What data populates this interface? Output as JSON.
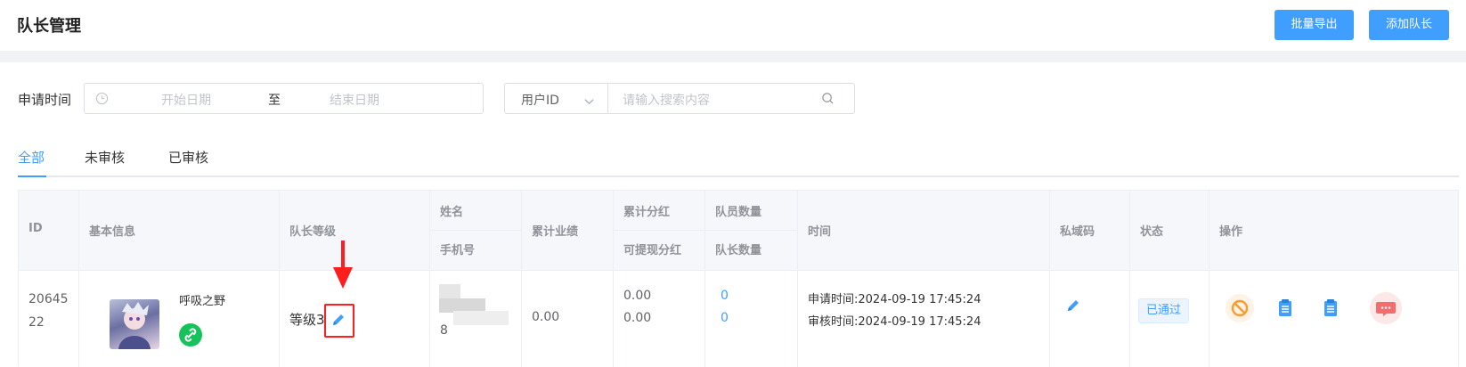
{
  "header": {
    "title": "队长管理",
    "export_label": "批量导出",
    "add_label": "添加队长"
  },
  "filters": {
    "date_label": "申请时间",
    "start_placeholder": "开始日期",
    "range_separator": "至",
    "end_placeholder": "结束日期",
    "search_field": "用户ID",
    "search_placeholder": "请输入搜索内容"
  },
  "tabs": [
    {
      "label": "全部",
      "active": true
    },
    {
      "label": "未审核",
      "active": false
    },
    {
      "label": "已审核",
      "active": false
    }
  ],
  "table": {
    "headers": {
      "id": "ID",
      "basic": "基本信息",
      "level": "队长等级",
      "name": "姓名",
      "phone": "手机号",
      "perf": "累计业绩",
      "dividend": "累计分红",
      "withdrawable": "可提现分红",
      "members": "队员数量",
      "leaders": "队长数量",
      "time": "时间",
      "qrcode": "私域码",
      "status": "状态",
      "ops": "操作"
    },
    "rows": [
      {
        "id_line1": "20645",
        "id_line2": "22",
        "nickname": "呼吸之野",
        "level": "等级3",
        "phone_tail": "8",
        "performance": "0.00",
        "dividend": "0.00",
        "withdrawable": "0.00",
        "members": "0",
        "leaders": "0",
        "apply_label": "申请时间:",
        "apply_time": "2024-09-19 17:45:24",
        "review_label": "审核时间:",
        "review_time": "2024-09-19 17:45:24",
        "status": "已通过"
      }
    ]
  },
  "colors": {
    "primary": "#409eff",
    "highlight": "#ff1e1e",
    "ban": "#ff9a2e",
    "message": "#f56c6c",
    "wechat": "#16c35a"
  },
  "icons": [
    "clock-icon",
    "search-icon",
    "chevron-down-icon",
    "edit-pencil-icon",
    "link-icon",
    "ban-icon",
    "clipboard-icon",
    "message-icon"
  ]
}
